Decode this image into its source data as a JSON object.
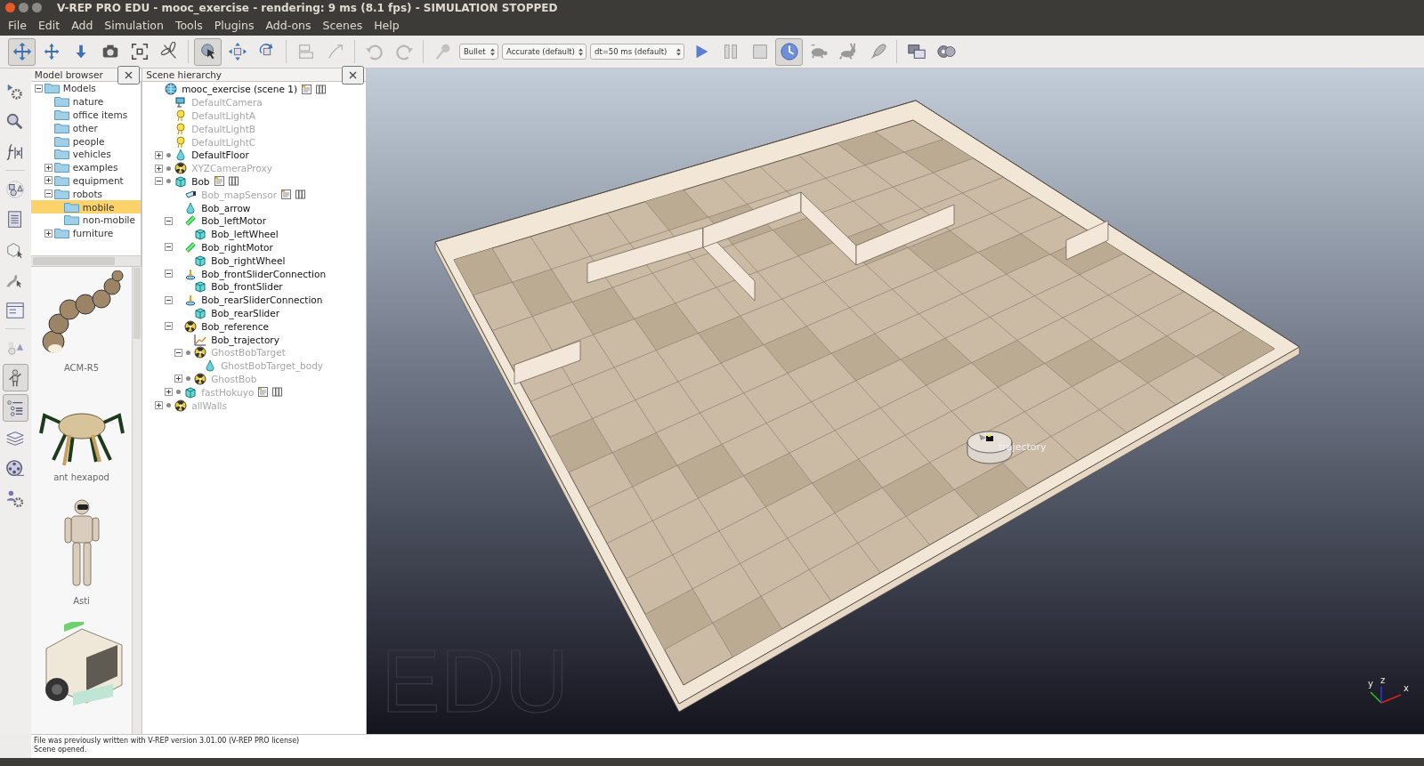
{
  "window": {
    "title": "V-REP PRO EDU - mooc_exercise - rendering: 9 ms (8.1 fps) - SIMULATION STOPPED"
  },
  "menu": [
    "File",
    "Edit",
    "Add",
    "Simulation",
    "Tools",
    "Plugins",
    "Add-ons",
    "Scenes",
    "Help"
  ],
  "toolbar": [
    {
      "kind": "button",
      "pressed": true,
      "disabled": false
    },
    {
      "kind": "button",
      "pressed": false,
      "disabled": false
    },
    {
      "kind": "button",
      "pressed": false,
      "disabled": false
    },
    {
      "kind": "button",
      "pressed": false,
      "disabled": false
    },
    {
      "kind": "button",
      "pressed": false,
      "disabled": false
    },
    {
      "kind": "button",
      "pressed": false,
      "disabled": false
    },
    {
      "kind": "separator"
    },
    {
      "kind": "button",
      "pressed": true,
      "disabled": false
    },
    {
      "kind": "button",
      "pressed": false,
      "disabled": false
    },
    {
      "kind": "button",
      "pressed": false,
      "disabled": false
    },
    {
      "kind": "separator"
    },
    {
      "kind": "button",
      "pressed": false,
      "disabled": true
    },
    {
      "kind": "button",
      "pressed": false,
      "disabled": true
    },
    {
      "kind": "separator"
    },
    {
      "kind": "button",
      "pressed": false,
      "disabled": true
    },
    {
      "kind": "button",
      "pressed": false,
      "disabled": true
    },
    {
      "kind": "separator"
    },
    {
      "kind": "button",
      "pressed": false,
      "disabled": true
    },
    {
      "kind": "dropdown",
      "value": "Bullet"
    },
    {
      "kind": "dropdown",
      "value": "Accurate (default)"
    },
    {
      "kind": "dropdown",
      "value": "dt=50 ms (default)"
    },
    {
      "kind": "button",
      "pressed": false,
      "disabled": false
    },
    {
      "kind": "button",
      "pressed": false,
      "disabled": false
    },
    {
      "kind": "button",
      "pressed": false,
      "disabled": false
    },
    {
      "kind": "button",
      "pressed": true,
      "disabled": false
    },
    {
      "kind": "button",
      "pressed": false,
      "disabled": false
    },
    {
      "kind": "button",
      "pressed": false,
      "disabled": false
    },
    {
      "kind": "button",
      "pressed": false,
      "disabled": false
    },
    {
      "kind": "separator"
    },
    {
      "kind": "button",
      "pressed": false,
      "disabled": false
    },
    {
      "kind": "button",
      "pressed": false,
      "disabled": false
    }
  ],
  "side_toolbar": [
    {
      "kind": "button",
      "pressed": false
    },
    {
      "kind": "button",
      "pressed": false
    },
    {
      "kind": "button",
      "pressed": false
    },
    {
      "kind": "separator"
    },
    {
      "kind": "button",
      "pressed": false
    },
    {
      "kind": "button",
      "pressed": false
    },
    {
      "kind": "button",
      "pressed": false
    },
    {
      "kind": "button",
      "pressed": false
    },
    {
      "kind": "button",
      "pressed": false
    },
    {
      "kind": "separator"
    },
    {
      "kind": "button",
      "pressed": false
    },
    {
      "kind": "button",
      "pressed": true
    },
    {
      "kind": "button",
      "pressed": true
    },
    {
      "kind": "button",
      "pressed": false
    },
    {
      "kind": "button",
      "pressed": false
    },
    {
      "kind": "button",
      "pressed": false
    }
  ],
  "model_browser": {
    "title": "Model browser",
    "tree": [
      {
        "label": "Models",
        "has_children": true,
        "expanded": true,
        "selected": false,
        "children": [
          {
            "label": "nature",
            "has_children": false,
            "selected": false
          },
          {
            "label": "office items",
            "has_children": false,
            "selected": false
          },
          {
            "label": "other",
            "has_children": false,
            "selected": false
          },
          {
            "label": "people",
            "has_children": false,
            "selected": false
          },
          {
            "label": "vehicles",
            "has_children": false,
            "selected": false
          },
          {
            "label": "examples",
            "has_children": true,
            "expanded": false,
            "selected": false
          },
          {
            "label": "equipment",
            "has_children": true,
            "expanded": false,
            "selected": false
          },
          {
            "label": "robots",
            "has_children": true,
            "expanded": true,
            "selected": false,
            "children": [
              {
                "label": "mobile",
                "has_children": false,
                "selected": true
              },
              {
                "label": "non-mobile",
                "has_children": false,
                "selected": false
              }
            ]
          },
          {
            "label": "furniture",
            "has_children": true,
            "expanded": false,
            "selected": false
          }
        ]
      }
    ],
    "models": [
      {
        "label": "ACM-R5"
      },
      {
        "label": "ant hexapod"
      },
      {
        "label": "Asti"
      }
    ]
  },
  "scene_hierarchy": {
    "title": "Scene hierarchy",
    "tree": [
      {
        "label": "mooc_exercise (scene 1)",
        "kind": "scene",
        "has_children": false,
        "model": false,
        "dimmed": false,
        "has_script": true,
        "children": [
          {
            "label": "DefaultCamera",
            "kind": "camera",
            "has_children": false,
            "model": false,
            "dimmed": true,
            "has_script": false
          },
          {
            "label": "DefaultLightA",
            "kind": "light",
            "has_children": false,
            "model": false,
            "dimmed": true,
            "has_script": false
          },
          {
            "label": "DefaultLightB",
            "kind": "light",
            "has_children": false,
            "model": false,
            "dimmed": true,
            "has_script": false
          },
          {
            "label": "DefaultLightC",
            "kind": "light",
            "has_children": false,
            "model": false,
            "dimmed": true,
            "has_script": false
          },
          {
            "label": "DefaultFloor",
            "kind": "cone",
            "has_children": true,
            "expanded": false,
            "model": true,
            "dimmed": false,
            "has_script": false
          },
          {
            "label": "XYZCameraProxy",
            "kind": "dummy",
            "has_children": true,
            "expanded": false,
            "model": true,
            "dimmed": true,
            "has_script": false
          },
          {
            "label": "Bob",
            "kind": "cube",
            "has_children": true,
            "expanded": true,
            "model": true,
            "dimmed": false,
            "has_script": true,
            "children": [
              {
                "label": "Bob_mapSensor",
                "kind": "sensor",
                "has_children": false,
                "model": false,
                "dimmed": true,
                "has_script": true
              },
              {
                "label": "Bob_arrow",
                "kind": "cone",
                "has_children": false,
                "model": false,
                "dimmed": false,
                "has_script": false
              },
              {
                "label": "Bob_leftMotor",
                "kind": "joint",
                "has_children": true,
                "expanded": true,
                "model": false,
                "dimmed": false,
                "has_script": false,
                "children": [
                  {
                    "label": "Bob_leftWheel",
                    "kind": "cube",
                    "has_children": false,
                    "model": false,
                    "dimmed": false,
                    "has_script": false
                  }
                ]
              },
              {
                "label": "Bob_rightMotor",
                "kind": "joint",
                "has_children": true,
                "expanded": true,
                "model": false,
                "dimmed": false,
                "has_script": false,
                "children": [
                  {
                    "label": "Bob_rightWheel",
                    "kind": "cube",
                    "has_children": false,
                    "model": false,
                    "dimmed": false,
                    "has_script": false
                  }
                ]
              },
              {
                "label": "Bob_frontSliderConnection",
                "kind": "connector",
                "has_children": true,
                "expanded": true,
                "model": false,
                "dimmed": false,
                "has_script": false,
                "children": [
                  {
                    "label": "Bob_frontSlider",
                    "kind": "cube",
                    "has_children": false,
                    "model": false,
                    "dimmed": false,
                    "has_script": false
                  }
                ]
              },
              {
                "label": "Bob_rearSliderConnection",
                "kind": "connector",
                "has_children": true,
                "expanded": true,
                "model": false,
                "dimmed": false,
                "has_script": false,
                "children": [
                  {
                    "label": "Bob_rearSlider",
                    "kind": "cube",
                    "has_children": false,
                    "model": false,
                    "dimmed": false,
                    "has_script": false
                  }
                ]
              },
              {
                "label": "Bob_reference",
                "kind": "dummy",
                "has_children": true,
                "expanded": true,
                "model": false,
                "dimmed": false,
                "has_script": false,
                "children": [
                  {
                    "label": "Bob_trajectory",
                    "kind": "graph",
                    "has_children": false,
                    "model": false,
                    "dimmed": false,
                    "has_script": false
                  },
                  {
                    "label": "GhostBobTarget",
                    "kind": "dummy",
                    "has_children": true,
                    "expanded": true,
                    "model": true,
                    "dimmed": true,
                    "has_script": false,
                    "children": [
                      {
                        "label": "GhostBobTarget_body",
                        "kind": "cone",
                        "has_children": false,
                        "model": false,
                        "dimmed": true,
                        "has_script": false
                      }
                    ]
                  },
                  {
                    "label": "GhostBob",
                    "kind": "dummy",
                    "has_children": true,
                    "expanded": false,
                    "model": true,
                    "dimmed": true,
                    "has_script": false
                  }
                ]
              },
              {
                "label": "fastHokuyo",
                "kind": "cube",
                "has_children": true,
                "expanded": false,
                "model": true,
                "dimmed": true,
                "has_script": true
              }
            ]
          },
          {
            "label": "allWalls",
            "kind": "dummy",
            "has_children": true,
            "expanded": false,
            "model": true,
            "dimmed": true,
            "has_script": false
          }
        ]
      }
    ]
  },
  "viewport": {
    "object_label": "trajectory",
    "edition_mark": "EDU",
    "axes": [
      "y",
      "z",
      "x"
    ]
  },
  "status_bar": {
    "lines": [
      "File was previously written with V-REP version 3.01.00 (V-REP PRO license)",
      "Scene opened."
    ]
  }
}
